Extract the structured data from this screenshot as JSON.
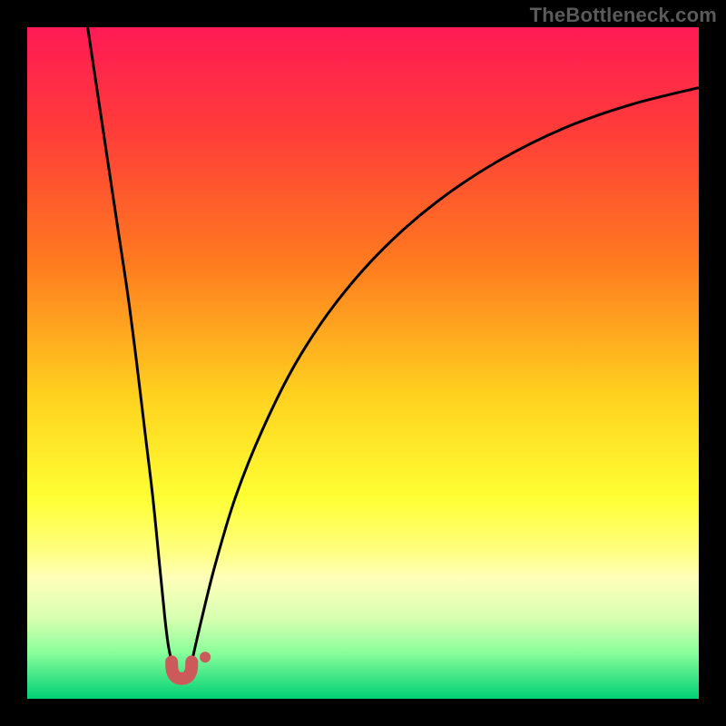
{
  "attribution": "TheBottleneck.com",
  "chart_data": {
    "type": "line",
    "title": "",
    "xlabel": "",
    "ylabel": "",
    "xlim": [
      0,
      100
    ],
    "ylim": [
      0,
      100
    ],
    "gradient_stops": [
      {
        "offset": 0,
        "color": "#ff1a55"
      },
      {
        "offset": 15,
        "color": "#ff3b3a"
      },
      {
        "offset": 35,
        "color": "#ff7a1f"
      },
      {
        "offset": 55,
        "color": "#ffd21f"
      },
      {
        "offset": 70,
        "color": "#ffff33"
      },
      {
        "offset": 78,
        "color": "#ffff80"
      },
      {
        "offset": 82,
        "color": "#ffffbb"
      },
      {
        "offset": 88,
        "color": "#d8ffb0"
      },
      {
        "offset": 93,
        "color": "#8cff9c"
      },
      {
        "offset": 100,
        "color": "#00d074"
      }
    ],
    "series": [
      {
        "name": "left-curve",
        "type": "line",
        "points": [
          {
            "x": 9,
            "y": 100
          },
          {
            "x": 10.5,
            "y": 90
          },
          {
            "x": 12,
            "y": 80
          },
          {
            "x": 13.5,
            "y": 70
          },
          {
            "x": 15,
            "y": 60
          },
          {
            "x": 16.3,
            "y": 50
          },
          {
            "x": 17.5,
            "y": 40
          },
          {
            "x": 18.7,
            "y": 30
          },
          {
            "x": 19.7,
            "y": 20
          },
          {
            "x": 20.5,
            "y": 12
          },
          {
            "x": 21,
            "y": 8
          },
          {
            "x": 21.5,
            "y": 5.5
          }
        ]
      },
      {
        "name": "right-curve",
        "type": "line",
        "points": [
          {
            "x": 24.5,
            "y": 5.5
          },
          {
            "x": 26,
            "y": 12
          },
          {
            "x": 28,
            "y": 20
          },
          {
            "x": 31,
            "y": 30
          },
          {
            "x": 35,
            "y": 40
          },
          {
            "x": 40,
            "y": 50
          },
          {
            "x": 46,
            "y": 59
          },
          {
            "x": 53,
            "y": 67
          },
          {
            "x": 61,
            "y": 74
          },
          {
            "x": 70,
            "y": 80
          },
          {
            "x": 80,
            "y": 85
          },
          {
            "x": 90,
            "y": 88.5
          },
          {
            "x": 100,
            "y": 91
          }
        ]
      },
      {
        "name": "bottom-u",
        "type": "marker",
        "color": "#cc5a5a",
        "points": [
          {
            "x": 21.5,
            "y": 5.5
          },
          {
            "x": 21.6,
            "y": 4.2
          },
          {
            "x": 22.1,
            "y": 3.3
          },
          {
            "x": 23.0,
            "y": 3.0
          },
          {
            "x": 23.9,
            "y": 3.3
          },
          {
            "x": 24.4,
            "y": 4.2
          },
          {
            "x": 24.5,
            "y": 5.5
          }
        ]
      },
      {
        "name": "side-dot",
        "type": "marker",
        "color": "#cc5a5a",
        "points": [
          {
            "x": 26.5,
            "y": 6.2
          }
        ]
      }
    ]
  }
}
